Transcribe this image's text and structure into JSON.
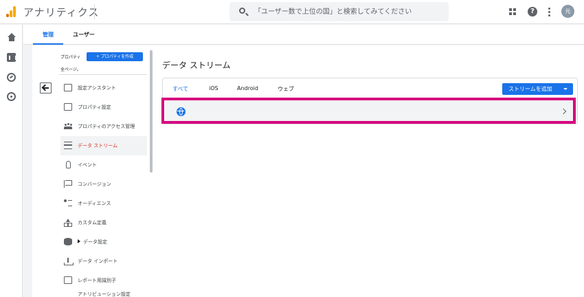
{
  "header": {
    "app_title": "アナリティクス",
    "search_placeholder": "「ユーザー数で上位の国」と検索してみてください",
    "avatar_initial": "元"
  },
  "tabs": [
    {
      "label": "管理"
    },
    {
      "label": "ユーザー"
    }
  ],
  "property": {
    "label": "プロパティ",
    "create_label": "プロパティを作成",
    "all_pages": "全ページ。"
  },
  "nav": {
    "items": [
      {
        "label": "設定アシスタント",
        "icon": "checklist-icon"
      },
      {
        "label": "プロパティ設定",
        "icon": "property-settings-icon"
      },
      {
        "label": "プロパティのアクセス管理",
        "icon": "people-icon"
      },
      {
        "label": "データ ストリーム",
        "icon": "data-stream-icon"
      },
      {
        "label": "イベント",
        "icon": "touch-icon"
      },
      {
        "label": "コンバージョン",
        "icon": "flag-icon"
      },
      {
        "label": "オーディエンス",
        "icon": "audience-icon"
      },
      {
        "label": "カスタム定義",
        "icon": "shapes-icon"
      },
      {
        "label": "データ設定",
        "icon": "database-icon"
      },
      {
        "label": "データ インポート",
        "icon": "upload-icon"
      },
      {
        "label": "レポート用識別子",
        "icon": "identifier-icon"
      }
    ],
    "partial_item": "アトリビューション設定"
  },
  "main": {
    "title": "データ ストリーム",
    "filter_tabs": [
      {
        "label": "すべて"
      },
      {
        "label": "iOS"
      },
      {
        "label": "Android"
      },
      {
        "label": "ウェブ"
      }
    ],
    "add_stream_label": "ストリームを追加"
  },
  "colors": {
    "accent": "#1a73e8",
    "active_nav": "#d93025",
    "highlight": "#d7007f",
    "logo_dark": "#e37400",
    "logo_light": "#f9ab00"
  },
  "icons": {
    "plus": "+",
    "help": "?"
  }
}
